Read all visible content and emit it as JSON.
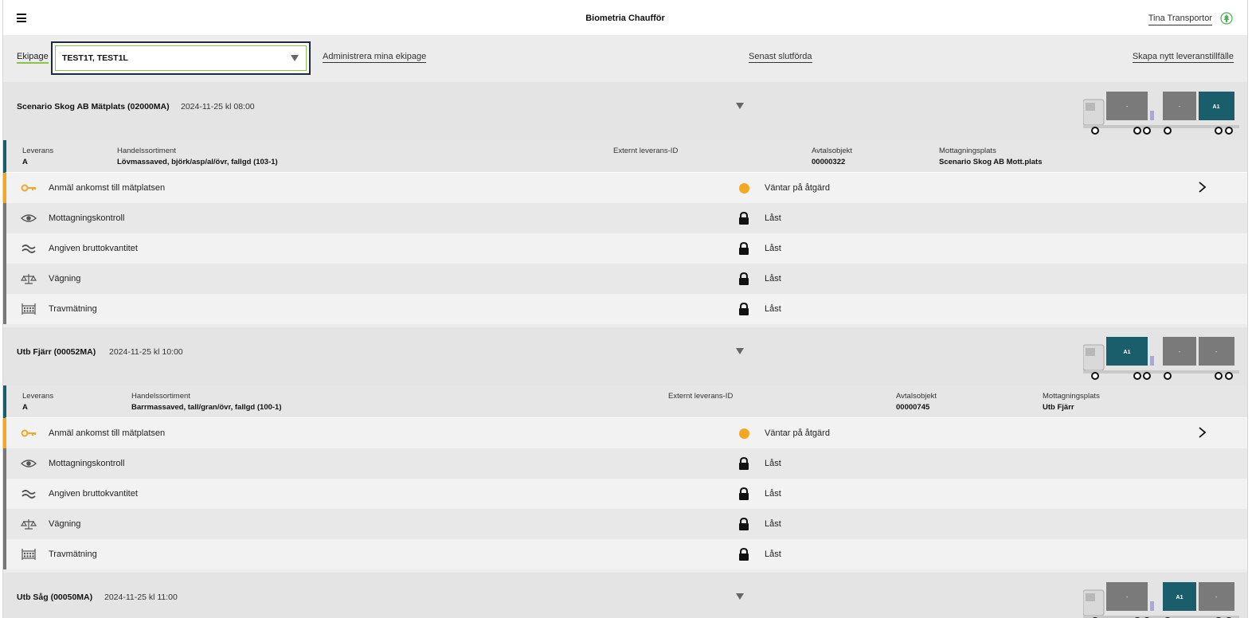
{
  "header": {
    "title": "Biometria Chaufför",
    "user": "Tina Transportor",
    "menu_icon": "hamburger-icon",
    "user_icon": "tree-icon"
  },
  "toolbar": {
    "ekipage_label": "Ekipage",
    "ekipage_value": "TEST1T, TEST1L",
    "admin_link": "Administrera mina ekipage",
    "recent_link": "Senast slutförda",
    "create_link": "Skapa nytt leveranstillfälle"
  },
  "colors": {
    "accent_green": "#8bc34a",
    "teal": "#1a5e6b",
    "pending": "#f5a623",
    "container_gray": "#7a7a7a"
  },
  "labels": {
    "delivery": "Leverans",
    "assortment": "Handelssortiment",
    "external_id": "Externt leverans-ID",
    "contract": "Avtalsobjekt",
    "receiving": "Mottagningsplats"
  },
  "deliveries": [
    {
      "name": "Scenario Skog AB Mätplats (02000MA)",
      "time": "2024-11-25 kl 08:00",
      "containers": [
        "-",
        "-",
        "A1"
      ],
      "delivery": "A",
      "assortment": "Lövmassaved, björk/asp/al/övr, fallgd (103-1)",
      "external_id": "",
      "contract": "00000322",
      "receiving": "Scenario Skog AB Mott.plats"
    },
    {
      "name": "Utb Fjärr (00052MA)",
      "time": "2024-11-25 kl 10:00",
      "containers": [
        "A1",
        "-",
        "-"
      ],
      "delivery": "A",
      "assortment": "Barrmassaved, tall/gran/övr, fallgd (100-1)",
      "external_id": "",
      "contract": "00000745",
      "receiving": "Utb Fjärr"
    },
    {
      "name": "Utb Såg (00050MA)",
      "time": "2024-11-25 kl 11:00",
      "containers": [
        "-",
        "A1",
        "-"
      ]
    }
  ],
  "steps": [
    {
      "label": "Anmäl ankomst till mätplatsen",
      "icon": "key-icon",
      "status": "Väntar på åtgärd",
      "status_icon": "pending-dot-icon"
    },
    {
      "label": "Mottagningskontroll",
      "icon": "eye-icon",
      "status": "Låst",
      "status_icon": "lock-icon"
    },
    {
      "label": "Angiven bruttokvantitet",
      "icon": "approx-icon",
      "status": "Låst",
      "status_icon": "lock-icon"
    },
    {
      "label": "Vägning",
      "icon": "scale-icon",
      "status": "Låst",
      "status_icon": "lock-icon"
    },
    {
      "label": "Travmätning",
      "icon": "log-stack-icon",
      "status": "Låst",
      "status_icon": "lock-icon"
    }
  ]
}
